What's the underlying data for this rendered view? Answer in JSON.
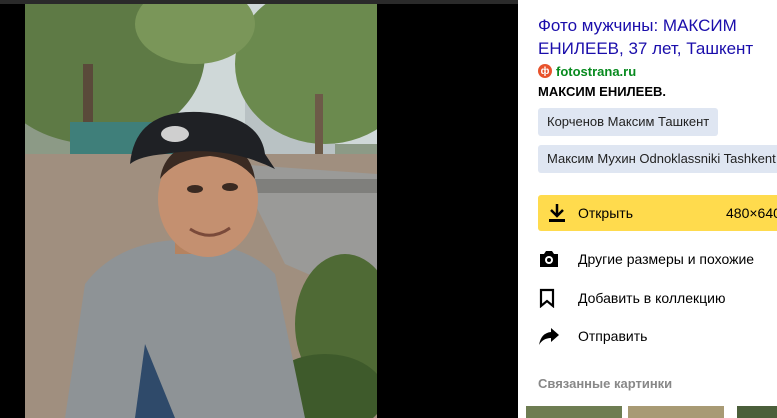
{
  "result": {
    "title": "Фото мужчины: МАКСИМ ЕНИЛЕЕВ, 37 лет, Ташкент",
    "source": "fotostrana.ru",
    "description": "МАКСИМ ЕНИЛЕЕВ."
  },
  "tags": [
    "Корченов Максим Ташкент",
    "Максим Мухин Odnoklassniki Tashkent"
  ],
  "open_button": {
    "label": "Открыть",
    "size": "480×640"
  },
  "actions": {
    "similar": "Другие размеры и похожие",
    "collection": "Добавить в коллекцию",
    "share": "Отправить"
  },
  "related": {
    "heading": "Связанные картинки"
  },
  "colors": {
    "link": "#1a0dab",
    "source": "#078a1e",
    "accent": "#ffdb4d",
    "tag_bg": "#dfe6f2"
  },
  "icons": [
    "fotostrana-logo-icon",
    "download-icon",
    "camera-search-icon",
    "bookmark-icon",
    "share-arrow-icon"
  ]
}
